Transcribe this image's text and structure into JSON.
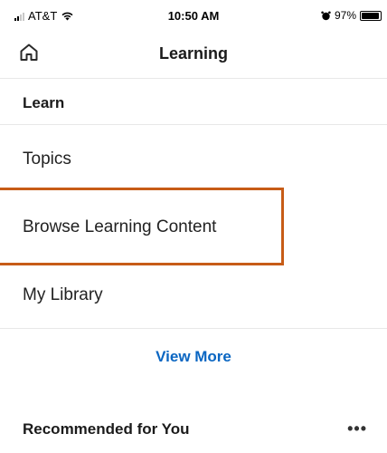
{
  "status_bar": {
    "carrier": "AT&T",
    "time": "10:50 AM",
    "battery": "97%",
    "battery_level": 0.97
  },
  "header": {
    "home_icon": "home-icon",
    "title": "Learning"
  },
  "learn_section": {
    "title": "Learn",
    "items": [
      {
        "label": "Topics"
      },
      {
        "label": "Browse Learning Content"
      },
      {
        "label": "My Library"
      }
    ],
    "view_more": "View More"
  },
  "recommended": {
    "title": "Recommended for You",
    "more_icon": "more-icon",
    "more_glyph": "•••"
  },
  "colors": {
    "highlight": "#c75c17",
    "link": "#0a66c2"
  }
}
